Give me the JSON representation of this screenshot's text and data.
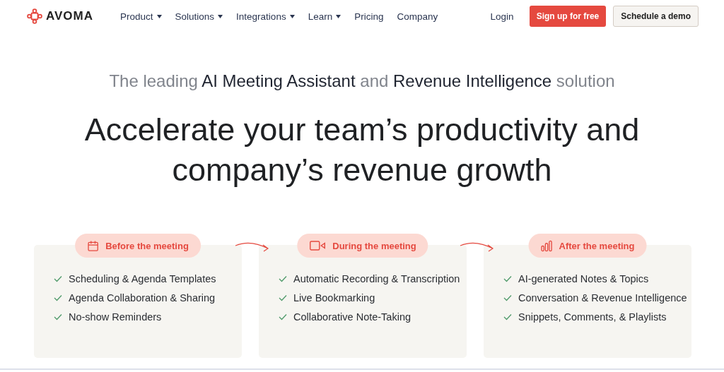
{
  "brand": {
    "name": "AVOMA"
  },
  "nav": [
    {
      "label": "Product",
      "dropdown": true
    },
    {
      "label": "Solutions",
      "dropdown": true
    },
    {
      "label": "Integrations",
      "dropdown": true
    },
    {
      "label": "Learn",
      "dropdown": true
    },
    {
      "label": "Pricing",
      "dropdown": false
    },
    {
      "label": "Company",
      "dropdown": false
    }
  ],
  "actions": {
    "login": "Login",
    "signup": "Sign up for free",
    "demo": "Schedule a demo"
  },
  "tagline": "The leading **AI Meeting Assistant** and **Revenue Intelligence** solution",
  "headline": [
    "Accelerate your team’s productivity and",
    "company’s revenue growth"
  ],
  "stages": [
    {
      "kind": "calendar",
      "title": "Before the meeting",
      "items": [
        "Scheduling & Agenda Templates",
        "Agenda Collaboration & Sharing",
        "No-show Reminders"
      ]
    },
    {
      "kind": "video",
      "title": "During the meeting",
      "items": [
        "Automatic Recording & Transcription",
        "Live Bookmarking",
        "Collaborative Note-Taking"
      ]
    },
    {
      "kind": "bars",
      "title": "After the meeting",
      "items": [
        "AI-generated Notes & Topics",
        "Conversation & Revenue Intelligence",
        "Snippets, Comments, & Playlists"
      ]
    }
  ]
}
